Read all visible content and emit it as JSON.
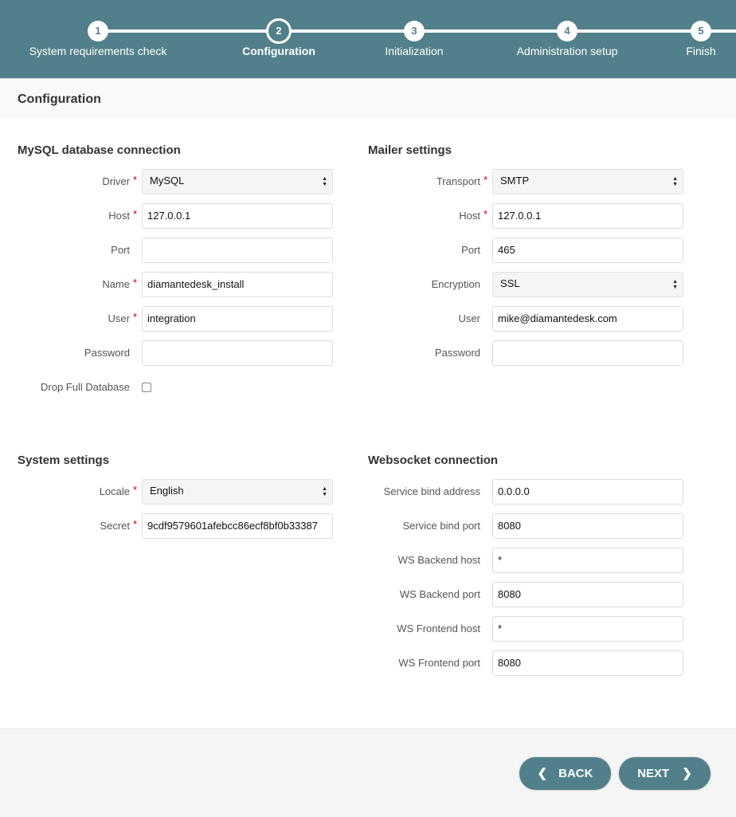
{
  "stepper": {
    "steps": [
      {
        "number": "1",
        "label": "System requirements check",
        "state": "done"
      },
      {
        "number": "2",
        "label": "Configuration",
        "state": "active"
      },
      {
        "number": "3",
        "label": "Initialization",
        "state": "pending"
      },
      {
        "number": "4",
        "label": "Administration setup",
        "state": "pending"
      },
      {
        "number": "5",
        "label": "Finish",
        "state": "pending"
      }
    ]
  },
  "page_title": "Configuration",
  "sections": [
    {
      "title": "MySQL database connection",
      "fields": [
        {
          "label": "Driver",
          "required": true,
          "type": "select",
          "value": "MySQL"
        },
        {
          "label": "Host",
          "required": true,
          "type": "text",
          "value": "127.0.0.1"
        },
        {
          "label": "Port",
          "required": false,
          "type": "text",
          "value": ""
        },
        {
          "label": "Name",
          "required": true,
          "type": "text",
          "value": "diamantedesk_install"
        },
        {
          "label": "User",
          "required": true,
          "type": "text",
          "value": "integration"
        },
        {
          "label": "Password",
          "required": false,
          "type": "password",
          "value": ""
        },
        {
          "label": "Drop Full Database",
          "required": false,
          "type": "checkbox",
          "checked": false
        }
      ]
    },
    {
      "title": "Mailer settings",
      "fields": [
        {
          "label": "Transport",
          "required": true,
          "type": "select",
          "value": "SMTP"
        },
        {
          "label": "Host",
          "required": true,
          "type": "text",
          "value": "127.0.0.1"
        },
        {
          "label": "Port",
          "required": false,
          "type": "text",
          "value": "465"
        },
        {
          "label": "Encryption",
          "required": false,
          "type": "select",
          "value": "SSL"
        },
        {
          "label": "User",
          "required": false,
          "type": "text",
          "value": "mike@diamantedesk.com"
        },
        {
          "label": "Password",
          "required": false,
          "type": "password",
          "value": ""
        }
      ]
    },
    {
      "title": "System settings",
      "fields": [
        {
          "label": "Locale",
          "required": true,
          "type": "select",
          "value": "English"
        },
        {
          "label": "Secret",
          "required": true,
          "type": "text",
          "value": "9cdf9579601afebcc86ecf8bf0b33387"
        }
      ]
    },
    {
      "title": "Websocket connection",
      "fields": [
        {
          "label": "Service bind address",
          "required": false,
          "type": "text",
          "value": "0.0.0.0"
        },
        {
          "label": "Service bind port",
          "required": false,
          "type": "text",
          "value": "8080"
        },
        {
          "label": "WS Backend host",
          "required": false,
          "type": "text",
          "value": "*"
        },
        {
          "label": "WS Backend port",
          "required": false,
          "type": "text",
          "value": "8080"
        },
        {
          "label": "WS Frontend host",
          "required": false,
          "type": "text",
          "value": "*"
        },
        {
          "label": "WS Frontend port",
          "required": false,
          "type": "text",
          "value": "8080"
        }
      ]
    }
  ],
  "footer": {
    "back_label": "BACK",
    "next_label": "NEXT",
    "back_icon": "chevron-left-icon",
    "next_icon": "chevron-right-icon"
  },
  "colors": {
    "accent": "#52808a",
    "required": "#cc0000"
  }
}
